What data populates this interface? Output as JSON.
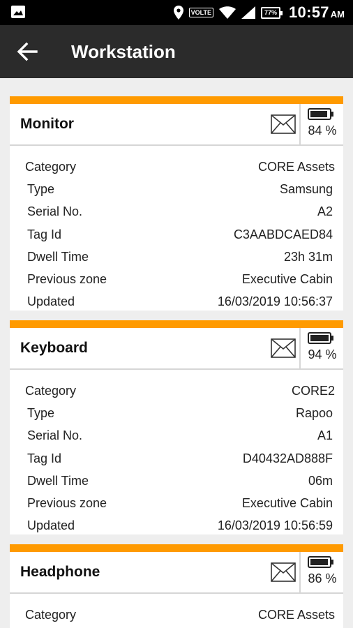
{
  "status_bar": {
    "volte": "VOLTE",
    "battery": "77%",
    "time": "10:57",
    "ampm": "AM"
  },
  "app_bar": {
    "title": "Workstation"
  },
  "colors": {
    "accent": "#ff9a00",
    "appbar": "#2b2b2b"
  },
  "cards": [
    {
      "name": "Monitor",
      "battery": "84 %",
      "details": [
        {
          "label": "Category",
          "value": "CORE Assets"
        },
        {
          "label": "Type",
          "value": "Samsung"
        },
        {
          "label": "Serial No.",
          "value": "A2"
        },
        {
          "label": "Tag Id",
          "value": "C3AABDCAED84"
        },
        {
          "label": "Dwell Time",
          "value": "23h 31m"
        },
        {
          "label": "Previous zone",
          "value": "Executive Cabin"
        },
        {
          "label": "Updated",
          "value": "16/03/2019 10:56:37"
        }
      ]
    },
    {
      "name": "Keyboard",
      "battery": "94 %",
      "details": [
        {
          "label": "Category",
          "value": "CORE2"
        },
        {
          "label": "Type",
          "value": "Rapoo"
        },
        {
          "label": "Serial No.",
          "value": "A1"
        },
        {
          "label": "Tag Id",
          "value": "D40432AD888F"
        },
        {
          "label": "Dwell Time",
          "value": "06m"
        },
        {
          "label": "Previous zone",
          "value": "Executive Cabin"
        },
        {
          "label": "Updated",
          "value": "16/03/2019 10:56:59"
        }
      ]
    },
    {
      "name": "Headphone",
      "battery": "86 %",
      "details": [
        {
          "label": "Category",
          "value": "CORE Assets"
        }
      ]
    }
  ]
}
